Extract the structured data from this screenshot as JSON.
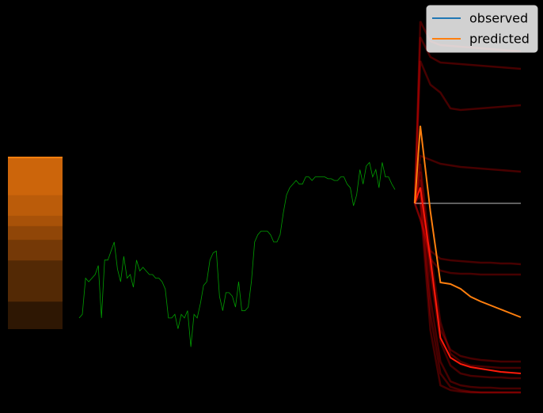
{
  "chart_data": {
    "type": "line",
    "title": "",
    "xlabel": "",
    "ylabel": "",
    "axes_visible": false,
    "grid": false,
    "legend": {
      "placement": "top-right",
      "entries": [
        {
          "label": "observed",
          "color": "#1f77b4"
        },
        {
          "label": "predicted",
          "color": "#ff7f0e"
        }
      ]
    },
    "colors": {
      "background": "#000000",
      "history_line": "#00a000",
      "observed_baseline": "#ffffff",
      "forecast_fan": "#ff0000",
      "predicted_main": "#ff7f0e",
      "red_main": "#ff1a0a"
    },
    "x_range": [
      0,
      100
    ],
    "y_range": [
      0,
      100
    ],
    "distribution_bands": [
      {
        "y0": 0,
        "y1": 100,
        "opacity": 0.18
      },
      {
        "y0": 16,
        "y1": 100,
        "opacity": 0.18
      },
      {
        "y0": 40,
        "y1": 100,
        "opacity": 0.2
      },
      {
        "y0": 52,
        "y1": 100,
        "opacity": 0.2
      },
      {
        "y0": 60,
        "y1": 100,
        "opacity": 0.22
      },
      {
        "y0": 66,
        "y1": 100,
        "opacity": 0.22
      },
      {
        "y0": 78,
        "y1": 100,
        "opacity": 0.25
      }
    ],
    "distribution_median": 100,
    "history": {
      "x": [
        0,
        1,
        2,
        3,
        4,
        5,
        6,
        7,
        8,
        9,
        10,
        11,
        12,
        13,
        14,
        15,
        16,
        17,
        18,
        19,
        20,
        21,
        22,
        23,
        24,
        25,
        26,
        27,
        28,
        29,
        30,
        31,
        32,
        33,
        34,
        35,
        36,
        37,
        38,
        39,
        40,
        41,
        42,
        43,
        44,
        45,
        46,
        47,
        48,
        49,
        50,
        51,
        52,
        53,
        54,
        55,
        56,
        57,
        58,
        59,
        60,
        61,
        62,
        63,
        64,
        65,
        66,
        67,
        68,
        69,
        70,
        71,
        72,
        73,
        74,
        75,
        76,
        77,
        78,
        79,
        80,
        81,
        82,
        83,
        84,
        85,
        86,
        87,
        88,
        89,
        90,
        91,
        92,
        93,
        94,
        95,
        96,
        97,
        98,
        99
      ],
      "y": [
        18,
        20,
        40,
        38,
        40,
        42,
        47,
        18,
        50,
        50,
        55,
        60,
        45,
        38,
        52,
        40,
        42,
        35,
        50,
        44,
        46,
        44,
        42,
        42,
        40,
        40,
        38,
        34,
        18,
        18,
        20,
        12,
        20,
        18,
        22,
        2,
        20,
        18,
        26,
        36,
        38,
        50,
        54,
        55,
        30,
        22,
        32,
        32,
        30,
        24,
        38,
        22,
        22,
        24,
        38,
        60,
        64,
        66,
        66,
        66,
        64,
        60,
        60,
        64,
        76,
        86,
        90,
        92,
        94,
        92,
        92,
        96,
        96,
        94,
        96,
        96,
        96,
        96,
        95,
        95,
        94,
        94,
        96,
        96,
        92,
        90,
        80,
        86,
        100,
        92,
        102,
        104,
        96,
        100,
        90,
        104,
        96,
        96,
        92,
        89
      ]
    },
    "observed": {
      "x": [
        0,
        100
      ],
      "y": [
        0,
        0
      ]
    },
    "forecast_fan": [
      {
        "y": [
          0,
          230,
          205,
          200,
          199,
          198,
          197,
          196,
          195,
          194,
          193,
          192
        ]
      },
      {
        "y": [
          0,
          210,
          185,
          178,
          177,
          176,
          175,
          174,
          173,
          172,
          171,
          170
        ]
      },
      {
        "y": [
          0,
          180,
          150,
          140,
          120,
          118,
          119,
          120,
          121,
          122,
          123,
          124
        ]
      },
      {
        "y": [
          0,
          60,
          55,
          50,
          48,
          46,
          45,
          44,
          43,
          42,
          41,
          40
        ]
      },
      {
        "y": [
          0,
          -20,
          -60,
          -70,
          -72,
          -73,
          -74,
          -75,
          -75,
          -76,
          -76,
          -77
        ]
      },
      {
        "y": [
          0,
          -20,
          -70,
          -85,
          -88,
          -89,
          -89,
          -90,
          -90,
          -90,
          -90,
          -90
        ]
      },
      {
        "y": [
          0,
          40,
          -80,
          -160,
          -185,
          -193,
          -196,
          -198,
          -199,
          -200,
          -200,
          -200
        ]
      },
      {
        "y": [
          0,
          50,
          -60,
          -150,
          -190,
          -200,
          -205,
          -206,
          -207,
          -208,
          -208,
          -208
        ]
      },
      {
        "y": [
          0,
          30,
          -90,
          -175,
          -205,
          -215,
          -218,
          -219,
          -220,
          -220,
          -221,
          -221
        ]
      },
      {
        "y": [
          0,
          20,
          -120,
          -200,
          -225,
          -230,
          -232,
          -233,
          -233,
          -234,
          -234,
          -234
        ]
      },
      {
        "y": [
          0,
          10,
          -140,
          -215,
          -232,
          -236,
          -238,
          -239,
          -239,
          -239,
          -239,
          -239
        ]
      },
      {
        "y": [
          0,
          0,
          -160,
          -230,
          -236,
          -238,
          -239,
          -239,
          -239,
          -239,
          -239,
          -239
        ]
      }
    ],
    "forecast_red_main": {
      "y": [
        0,
        20,
        -70,
        -170,
        -195,
        -203,
        -207,
        -209,
        -211,
        -213,
        -214,
        -215
      ]
    },
    "forecast_predicted": {
      "y": [
        0,
        98,
        -10,
        -100,
        -102,
        -108,
        -118,
        -124,
        -129,
        -134,
        -139,
        -144
      ]
    },
    "forecast_steps": [
      0,
      1,
      2,
      3,
      4,
      5,
      6,
      7,
      8,
      9,
      10,
      11
    ]
  }
}
